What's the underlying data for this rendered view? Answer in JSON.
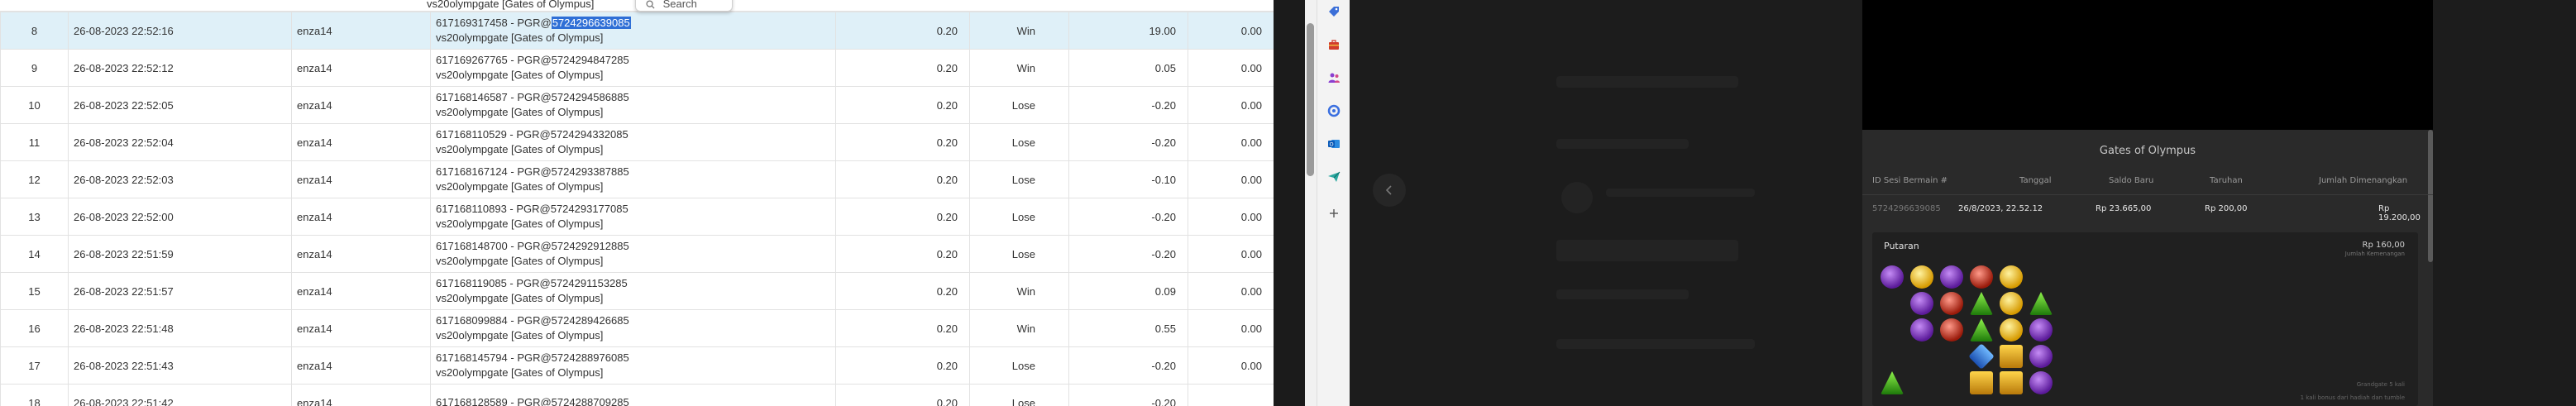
{
  "search_popup": {
    "label": "Search"
  },
  "table": {
    "rows": [
      {
        "no": "8",
        "datetime": "26-08-2023 22:52:16",
        "user": "enza14",
        "detail_prefix": "617169317458 - PGR@",
        "detail_highlight": "5724296639085",
        "detail_line2": "vs20olympgate [Gates of Olympus]",
        "bet": "0.20",
        "result": "Win",
        "win": "19.00",
        "extra": "0.00",
        "selected": true
      },
      {
        "no": "9",
        "datetime": "26-08-2023 22:52:12",
        "user": "enza14",
        "detail_prefix": "617169267765 - PGR@5724294847285",
        "detail_highlight": "",
        "detail_line2": "vs20olympgate [Gates of Olympus]",
        "bet": "0.20",
        "result": "Win",
        "win": "0.05",
        "extra": "0.00"
      },
      {
        "no": "10",
        "datetime": "26-08-2023 22:52:05",
        "user": "enza14",
        "detail_prefix": "617168146587 - PGR@5724294586885",
        "detail_highlight": "",
        "detail_line2": "vs20olympgate [Gates of Olympus]",
        "bet": "0.20",
        "result": "Lose",
        "win": "-0.20",
        "extra": "0.00"
      },
      {
        "no": "11",
        "datetime": "26-08-2023 22:52:04",
        "user": "enza14",
        "detail_prefix": "617168110529 - PGR@5724294332085",
        "detail_highlight": "",
        "detail_line2": "vs20olympgate [Gates of Olympus]",
        "bet": "0.20",
        "result": "Lose",
        "win": "-0.20",
        "extra": "0.00"
      },
      {
        "no": "12",
        "datetime": "26-08-2023 22:52:03",
        "user": "enza14",
        "detail_prefix": "617168167124 - PGR@5724293387885",
        "detail_highlight": "",
        "detail_line2": "vs20olympgate [Gates of Olympus]",
        "bet": "0.20",
        "result": "Lose",
        "win": "-0.10",
        "extra": "0.00"
      },
      {
        "no": "13",
        "datetime": "26-08-2023 22:52:00",
        "user": "enza14",
        "detail_prefix": "617168110893 - PGR@5724293177085",
        "detail_highlight": "",
        "detail_line2": "vs20olympgate [Gates of Olympus]",
        "bet": "0.20",
        "result": "Lose",
        "win": "-0.20",
        "extra": "0.00"
      },
      {
        "no": "14",
        "datetime": "26-08-2023 22:51:59",
        "user": "enza14",
        "detail_prefix": "617168148700 - PGR@5724292912885",
        "detail_highlight": "",
        "detail_line2": "vs20olympgate [Gates of Olympus]",
        "bet": "0.20",
        "result": "Lose",
        "win": "-0.20",
        "extra": "0.00"
      },
      {
        "no": "15",
        "datetime": "26-08-2023 22:51:57",
        "user": "enza14",
        "detail_prefix": "617168119085 - PGR@5724291153285",
        "detail_highlight": "",
        "detail_line2": "vs20olympgate [Gates of Olympus]",
        "bet": "0.20",
        "result": "Win",
        "win": "0.09",
        "extra": "0.00"
      },
      {
        "no": "16",
        "datetime": "26-08-2023 22:51:48",
        "user": "enza14",
        "detail_prefix": "617168099884 - PGR@5724289426685",
        "detail_highlight": "",
        "detail_line2": "vs20olympgate [Gates of Olympus]",
        "bet": "0.20",
        "result": "Win",
        "win": "0.55",
        "extra": "0.00"
      },
      {
        "no": "17",
        "datetime": "26-08-2023 22:51:43",
        "user": "enza14",
        "detail_prefix": "617168145794 - PGR@5724288976085",
        "detail_highlight": "",
        "detail_line2": "vs20olympgate [Gates of Olympus]",
        "bet": "0.20",
        "result": "Lose",
        "win": "-0.20",
        "extra": "0.00"
      },
      {
        "no": "18",
        "datetime": "26-08-2023 22:51:42",
        "user": "enza14",
        "detail_prefix": "617168128589 - PGR@5724288709285",
        "detail_highlight": "",
        "detail_line2": "",
        "bet": "0.20",
        "result": "Lose",
        "win": "-0.20",
        "extra": ""
      }
    ],
    "top_partial_text": "vs20olympgate [Gates of Olympus]"
  },
  "history": {
    "title": "Gates of Olympus",
    "headers": [
      "ID Sesi Bermain #",
      "Tanggal",
      "Saldo Baru",
      "Taruhan",
      "Jumlah Dimenangkan"
    ],
    "row": {
      "id": "5724296639085",
      "date": "26/8/2023, 22.52.12",
      "balance": "Rp 23.665,00",
      "bet": "Rp 200,00",
      "won": "Rp 19.200,00"
    },
    "spin": {
      "title": "Putaran",
      "amount": "Rp 160,00",
      "sub": "Jumlah Kemenangan",
      "note1": "Grandgate 5 kali",
      "note2": "1 kali bonus dari hadiah dan tumble"
    }
  },
  "colors": {
    "win": "#1e8e1e",
    "lose": "#e0231c",
    "selected_row": "#dff0f8",
    "highlight": "#2f6fd6"
  },
  "rail_icons": [
    "tag-icon",
    "toolbox-icon",
    "people-icon",
    "circle-icon",
    "outlook-icon",
    "paper-plane-icon",
    "plus-icon"
  ]
}
